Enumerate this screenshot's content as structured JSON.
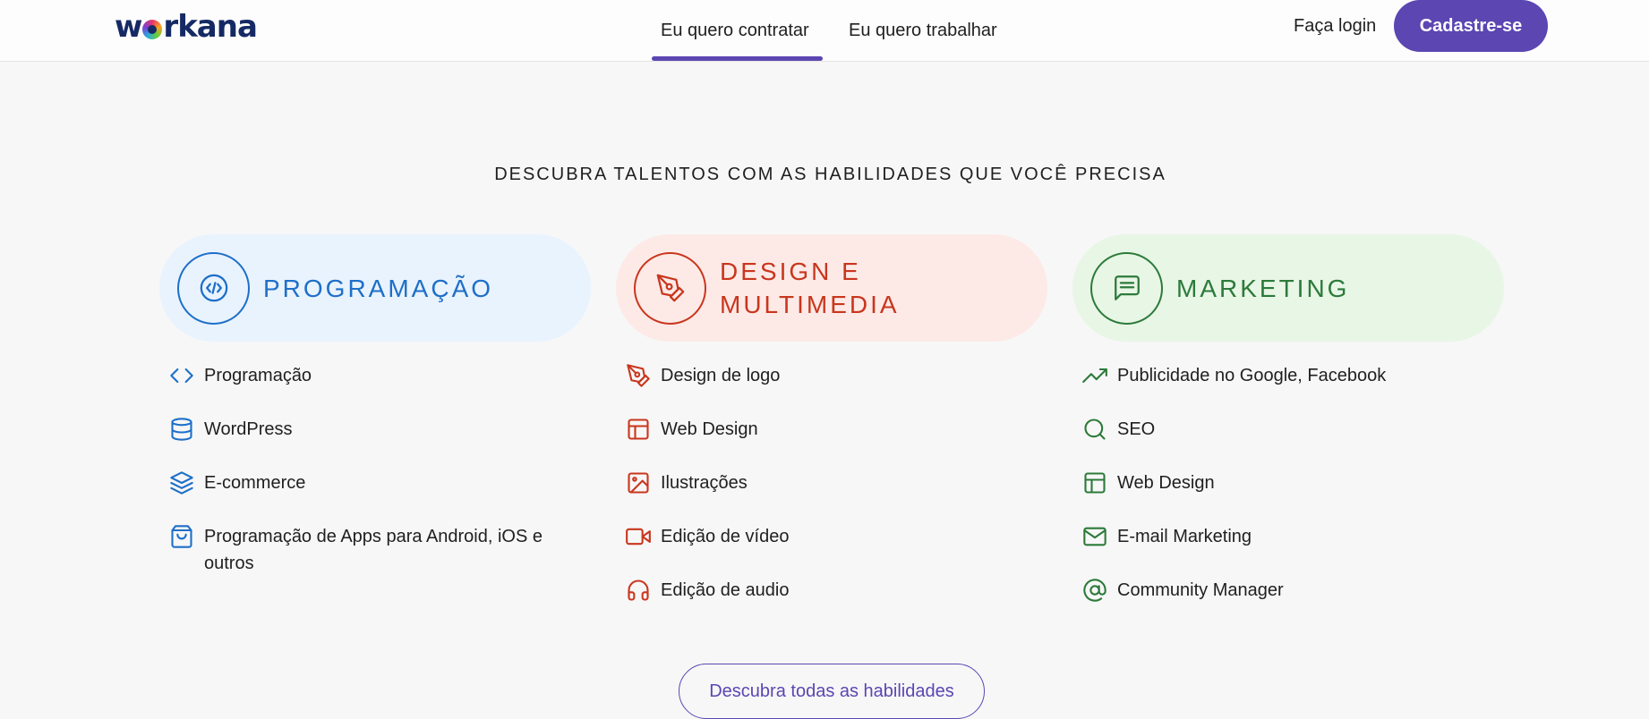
{
  "header": {
    "logo_text": "workana",
    "tabs": [
      {
        "label": "Eu quero contratar",
        "active": true
      },
      {
        "label": "Eu quero trabalhar",
        "active": false
      }
    ],
    "login_label": "Faça login",
    "signup_label": "Cadastre-se"
  },
  "section_title": "DESCUBRA TALENTOS COM AS HABILIDADES QUE VOCÊ PRECISA",
  "categories": [
    {
      "title": "PROGRAMAÇÃO",
      "icon": "code-circle-icon",
      "color": "#1e6fc9",
      "skills": [
        {
          "label": "Programação",
          "icon": "code-icon"
        },
        {
          "label": "WordPress",
          "icon": "database-icon"
        },
        {
          "label": "E-commerce",
          "icon": "layers-icon"
        },
        {
          "label": "Programação de Apps para Android, iOS e outros",
          "icon": "shopping-bag-icon"
        }
      ]
    },
    {
      "title": "DESIGN E MULTIMEDIA",
      "icon": "pen-tool-icon",
      "color": "#c9361d",
      "skills": [
        {
          "label": "Design de logo",
          "icon": "pen-tool-icon"
        },
        {
          "label": "Web Design",
          "icon": "layout-icon"
        },
        {
          "label": "Ilustrações",
          "icon": "image-icon"
        },
        {
          "label": "Edição de vídeo",
          "icon": "video-icon"
        },
        {
          "label": "Edição de audio",
          "icon": "headphones-icon"
        }
      ]
    },
    {
      "title": "MARKETING",
      "icon": "message-square-icon",
      "color": "#2c7a3a",
      "skills": [
        {
          "label": "Publicidade no Google, Facebook",
          "icon": "trending-up-icon"
        },
        {
          "label": "SEO",
          "icon": "search-icon"
        },
        {
          "label": "Web Design",
          "icon": "layout-icon"
        },
        {
          "label": "E-mail Marketing",
          "icon": "mail-icon"
        },
        {
          "label": "Community Manager",
          "icon": "at-sign-icon"
        }
      ]
    }
  ],
  "cta_label": "Descubra todas as habilidades",
  "colors": {
    "brand": "#5b46b2",
    "programming": "#1e6fc9",
    "design": "#c9361d",
    "marketing": "#2c7a3a"
  }
}
